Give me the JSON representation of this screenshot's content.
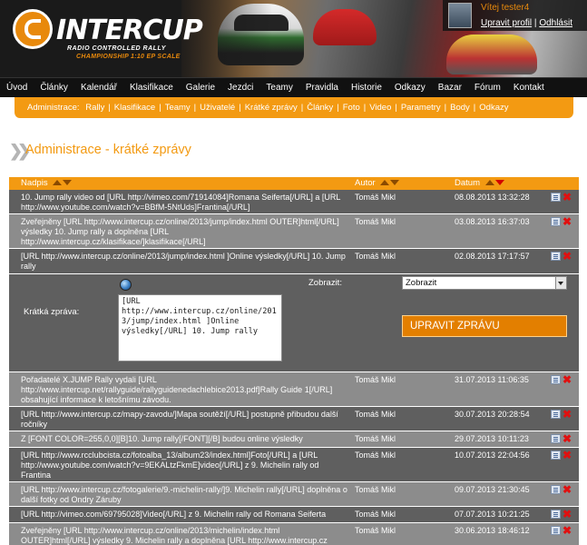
{
  "header": {
    "logo_text": "INTERCUP",
    "logo_sub1": "RADIO CONTROLLED RALLY",
    "logo_sub2": "CHAMPIONSHIP 1:10 EP SCALE",
    "greeting": "Vítej tester4",
    "profile_link": "Upravit profil",
    "divider": "|",
    "logout_link": "Odhlásit"
  },
  "mainnav": [
    "Úvod",
    "Články",
    "Kalendář",
    "Klasifikace",
    "Galerie",
    "Jezdci",
    "Teamy",
    "Pravidla",
    "Historie",
    "Odkazy",
    "Bazar",
    "Fórum",
    "Kontakt"
  ],
  "subnav": {
    "prefix": "Administrace:",
    "items": [
      "Rally",
      "Klasifikace",
      "Teamy",
      "Uživatelé",
      "Krátké zprávy",
      "Články",
      "Foto",
      "Video",
      "Parametry",
      "Body",
      "Odkazy"
    ]
  },
  "page_title": "Administrace - krátké zprávy",
  "table": {
    "headers": {
      "text": "Nadpis",
      "author": "Autor",
      "date": "Datum"
    },
    "rows_before": [
      {
        "text": "10. Jump rally video od [URL http://vimeo.com/71914084]Romana Seiferta[/URL] a [URL http://www.youtube.com/watch?v=BBfM-5NtUds]Frantina[/URL]",
        "author": "Tomáš Mikl",
        "date": "08.08.2013 13:32:28"
      },
      {
        "text": "Zveřejněny [URL http://www.intercup.cz/online/2013/jump/index.html OUTER]html[/URL] výsledky 10. Jump rally a doplněna [URL http://www.intercup.cz/klasifikace/]klasifikace[/URL]",
        "author": "Tomáš Mikl",
        "date": "03.08.2013 16:37:03"
      },
      {
        "text": "[URL http://www.intercup.cz/online/2013/jump/index.html ]Online výsledky[/URL] 10. Jump rally",
        "author": "Tomáš Mikl",
        "date": "02.08.2013 17:17:57"
      }
    ],
    "form": {
      "label": "Krátká zpráva:",
      "textarea_value": "[URL http://www.intercup.cz/online/2013/jump/index.html ]Online výsledky[/URL] 10. Jump rally",
      "show_label": "Zobrazit:",
      "show_value": "Zobrazit",
      "submit_label": "UPRAVIT ZPRÁVU"
    },
    "rows_after": [
      {
        "text": "Pořadatelé X.JUMP Rally vydali [URL http://www.intercup.net/rallyguide/rallyguidenedachlebice2013.pdf]Rally Guide 1[/URL] obsahující informace k letošnímu závodu.",
        "author": "Tomáš Mikl",
        "date": "31.07.2013 11:06:35"
      },
      {
        "text": "[URL http://www.intercup.cz/mapy-zavodu/]Mapa soutěží[/URL] postupně přibudou další ročníky",
        "author": "Tomáš Mikl",
        "date": "30.07.2013 20:28:54"
      },
      {
        "text": "Z [FONT COLOR=255,0,0][B]10. Jump rally[/FONT][/B] budou online výsledky",
        "author": "Tomáš Mikl",
        "date": "29.07.2013 10:11:23"
      },
      {
        "text": "[URL http://www.rcclubcista.cz/fotoalba_13/album23/index.html]Foto[/URL] a [URL http://www.youtube.com/watch?v=9EKALtzFkmE]video[/URL] z 9. Michelin rally od Frantina",
        "author": "Tomáš Mikl",
        "date": "10.07.2013 22:04:56"
      },
      {
        "text": "[URL http://www.intercup.cz/fotogalerie/9.-michelin-rally/]9. Michelin rally[/URL] doplněna o další fotky od Ondry Záruby",
        "author": "Tomáš Mikl",
        "date": "09.07.2013 21:30:45"
      },
      {
        "text": "[URL http://vimeo.com/69795028]Video[/URL] z 9. Michelin rally od Romana Seiferta",
        "author": "Tomáš Mikl",
        "date": "07.07.2013 10:21:25"
      },
      {
        "text": "Zveřejněny [URL http://www.intercup.cz/online/2013/michelin/index.html OUTER]html[/URL] výsledky 9. Michelin rally a doplněna [URL http://www.intercup.cz",
        "author": "Tomáš Mikl",
        "date": "30.06.2013 18:46:12"
      }
    ]
  }
}
